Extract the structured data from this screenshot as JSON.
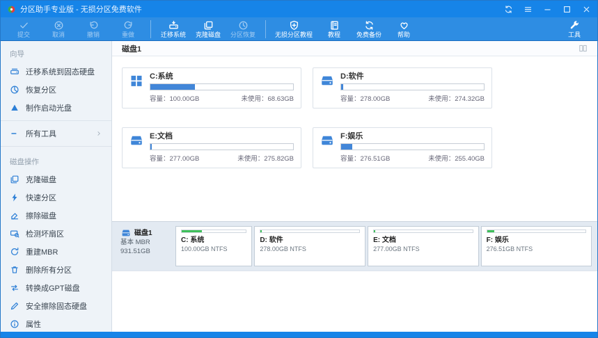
{
  "window": {
    "title": "分区助手专业版 - 无损分区免费软件",
    "logo_icon": "app-logo-icon",
    "controls": [
      {
        "name": "sync-button",
        "icon": "sync-icon"
      },
      {
        "name": "menu-button",
        "icon": "menu-icon"
      },
      {
        "name": "minimize-button",
        "icon": "minimize-icon"
      },
      {
        "name": "maximize-button",
        "icon": "maximize-icon"
      },
      {
        "name": "close-button",
        "icon": "close-icon"
      }
    ]
  },
  "toolbar": {
    "items": [
      {
        "name": "commit-button",
        "label": "提交",
        "icon": "check-icon",
        "disabled": true
      },
      {
        "name": "cancel-button",
        "label": "取消",
        "icon": "cancel-icon",
        "disabled": true
      },
      {
        "name": "undo-button",
        "label": "撤销",
        "icon": "undo-icon",
        "disabled": true
      },
      {
        "name": "redo-button",
        "label": "重做",
        "icon": "redo-icon",
        "disabled": true,
        "sep_after": true
      },
      {
        "name": "migrate-system-button",
        "label": "迁移系统",
        "icon": "migrate-system-icon"
      },
      {
        "name": "clone-disk-button",
        "label": "克隆磁盘",
        "icon": "clone-disk-icon"
      },
      {
        "name": "partition-recovery-button",
        "label": "分区恢复",
        "icon": "clock-icon",
        "disabled": true,
        "sep_after": true
      },
      {
        "name": "lossless-tutorial-button",
        "label": "无损分区教程",
        "icon": "shield-plus-icon"
      },
      {
        "name": "tutorial-button",
        "label": "教程",
        "icon": "tutorial-icon"
      },
      {
        "name": "free-backup-button",
        "label": "免费备份",
        "icon": "backup-icon"
      },
      {
        "name": "help-button",
        "label": "帮助",
        "icon": "heart-icon"
      },
      {
        "name": "tools-button",
        "label": "工具",
        "icon": "wrench-icon",
        "align": "right"
      }
    ]
  },
  "sidebar": {
    "sections": [
      {
        "title": "向导",
        "items": [
          {
            "name": "sidebar-item-migrate-os-to-ssd",
            "label": "迁移系统到固态硬盘",
            "icon": "hdd-icon"
          },
          {
            "name": "sidebar-item-recover-partition",
            "label": "恢复分区",
            "icon": "pie-icon"
          },
          {
            "name": "sidebar-item-make-bootable-cd",
            "label": "制作启动光盘",
            "icon": "bootdisc-icon"
          },
          {
            "name": "sidebar-item-all-tools",
            "label": "所有工具",
            "icon": "dash-icon",
            "chevron": true,
            "divider_before": true
          }
        ]
      },
      {
        "title": "磁盘操作",
        "items": [
          {
            "name": "sidebar-item-clone-disk",
            "label": "克隆磁盘",
            "icon": "clone-disk-icon"
          },
          {
            "name": "sidebar-item-quick-partition",
            "label": "快速分区",
            "icon": "lightning-icon"
          },
          {
            "name": "sidebar-item-wipe-disk",
            "label": "擦除磁盘",
            "icon": "eraser-icon"
          },
          {
            "name": "sidebar-item-check-bad-sectors",
            "label": "检测坏扇区",
            "icon": "disk-search-icon"
          },
          {
            "name": "sidebar-item-rebuild-mbr",
            "label": "重建MBR",
            "icon": "rebuild-icon"
          },
          {
            "name": "sidebar-item-delete-all-partitions",
            "label": "删除所有分区",
            "icon": "delete-icon"
          },
          {
            "name": "sidebar-item-convert-to-gpt",
            "label": "转换成GPT磁盘",
            "icon": "convert-icon"
          },
          {
            "name": "sidebar-item-secure-erase-ssd",
            "label": "安全擦除固态硬盘",
            "icon": "secure-erase-icon"
          },
          {
            "name": "sidebar-item-properties",
            "label": "属性",
            "icon": "info-icon"
          }
        ]
      }
    ]
  },
  "main": {
    "header": {
      "title": "磁盘1",
      "view_toggle_icon": "view-toggle-icon"
    },
    "labels": {
      "capacity": "容量：",
      "unused": "未使用："
    },
    "partitions": [
      {
        "name": "partition-c",
        "icon": "windows-logo-icon",
        "title": "C:系统",
        "capacity": "100.00GB",
        "unused": "68.63GB",
        "capacity_gb": 100.0,
        "unused_gb": 68.63,
        "map_label": "C: 系统",
        "map_detail": "100.00GB NTFS"
      },
      {
        "name": "partition-d",
        "icon": "drive-icon",
        "title": "D:软件",
        "capacity": "278.00GB",
        "unused": "274.32GB",
        "capacity_gb": 278.0,
        "unused_gb": 274.32,
        "map_label": "D: 软件",
        "map_detail": "278.00GB NTFS"
      },
      {
        "name": "partition-e",
        "icon": "drive-icon",
        "title": "E:文档",
        "capacity": "277.00GB",
        "unused": "275.82GB",
        "capacity_gb": 277.0,
        "unused_gb": 275.82,
        "map_label": "E: 文档",
        "map_detail": "277.00GB NTFS"
      },
      {
        "name": "partition-f",
        "icon": "drive-icon",
        "title": "F:娱乐",
        "capacity": "276.51GB",
        "unused": "255.40GB",
        "capacity_gb": 276.51,
        "unused_gb": 255.4,
        "map_label": "F: 娱乐",
        "map_detail": "276.51GB NTFS"
      }
    ]
  },
  "diskmap": {
    "disk": {
      "name": "磁盘1",
      "type": "基本 MBR",
      "size": "931.51GB",
      "icon": "drive-icon"
    }
  },
  "colors": {
    "titlebar": "#1684e8",
    "toolbar": "#2e8de3",
    "card_bar_fill": "#4286d8",
    "map_bar_fill": "#3fc05a",
    "sidebar_bg": "#eef3f8"
  }
}
